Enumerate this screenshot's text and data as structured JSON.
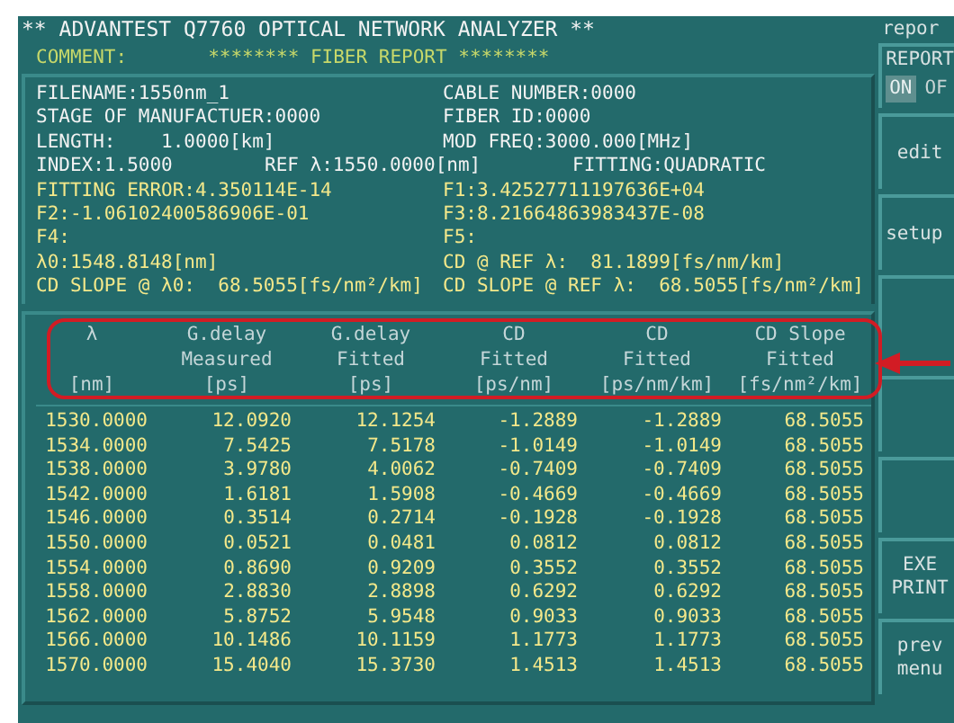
{
  "title": "** ADVANTEST Q7760 OPTICAL NETWORK ANALYZER **",
  "comment": {
    "label": "COMMENT:",
    "text": "******** FIBER REPORT ********"
  },
  "info_rows": [
    {
      "kind": "setting",
      "items": [
        "FILENAME:1550nm_1",
        "CABLE NUMBER:0000"
      ]
    },
    {
      "kind": "setting",
      "items": [
        "STAGE OF MANUFACTUER:0000",
        "FIBER ID:0000"
      ]
    },
    {
      "kind": "setting",
      "items": [
        "LENGTH:    1.0000[km]",
        "MOD FREQ:3000.000[MHz]"
      ]
    },
    {
      "kind": "setting",
      "items": [
        "INDEX:1.5000",
        "REF λ:1550.0000[nm]",
        "FITTING:QUADRATIC"
      ]
    },
    {
      "kind": "result",
      "items": [
        "FITTING ERROR:4.350114E-14",
        "F1:3.42527711197636E+04"
      ]
    },
    {
      "kind": "result",
      "items": [
        "F2:-1.06102400586906E-01",
        "F3:8.21664863983437E-08"
      ]
    },
    {
      "kind": "result",
      "items": [
        "F4:",
        "F5:"
      ]
    },
    {
      "kind": "result",
      "items": [
        "λ0:1548.8148[nm]",
        "CD @ REF λ:  81.1899[fs/nm/km]"
      ]
    },
    {
      "kind": "result",
      "items": [
        "CD SLOPE @ λ0:  68.5055[fs/nm²/km]",
        "CD SLOPE @ REF λ:  68.5055[fs/nm²/km]"
      ]
    }
  ],
  "table": {
    "header_highlighted": true,
    "columns": [
      {
        "lines": [
          "λ",
          "[nm]"
        ]
      },
      {
        "lines": [
          "G.delay",
          "Measured",
          "[ps]"
        ]
      },
      {
        "lines": [
          "G.delay",
          "Fitted",
          "[ps]"
        ]
      },
      {
        "lines": [
          "CD",
          "Fitted",
          "[ps/nm]"
        ]
      },
      {
        "lines": [
          "CD",
          "Fitted",
          "[ps/nm/km]"
        ]
      },
      {
        "lines": [
          "CD Slope",
          "Fitted",
          "[fs/nm²/km]"
        ]
      }
    ],
    "rows": [
      [
        "1530.0000",
        "12.0920",
        "12.1254",
        "-1.2889",
        "-1.2889",
        "68.5055"
      ],
      [
        "1534.0000",
        "7.5425",
        "7.5178",
        "-1.0149",
        "-1.0149",
        "68.5055"
      ],
      [
        "1538.0000",
        "3.9780",
        "4.0062",
        "-0.7409",
        "-0.7409",
        "68.5055"
      ],
      [
        "1542.0000",
        "1.6181",
        "1.5908",
        "-0.4669",
        "-0.4669",
        "68.5055"
      ],
      [
        "1546.0000",
        "0.3514",
        "0.2714",
        "-0.1928",
        "-0.1928",
        "68.5055"
      ],
      [
        "1550.0000",
        "0.0521",
        "0.0481",
        "0.0812",
        "0.0812",
        "68.5055"
      ],
      [
        "1554.0000",
        "0.8690",
        "0.9209",
        "0.3552",
        "0.3552",
        "68.5055"
      ],
      [
        "1558.0000",
        "2.8830",
        "2.8898",
        "0.6292",
        "0.6292",
        "68.5055"
      ],
      [
        "1562.0000",
        "5.8752",
        "5.9548",
        "0.9033",
        "0.9033",
        "68.5055"
      ],
      [
        "1566.0000",
        "10.1486",
        "10.1159",
        "1.1773",
        "1.1773",
        "68.5055"
      ],
      [
        "1570.0000",
        "15.4040",
        "15.3730",
        "1.4513",
        "1.4513",
        "68.5055"
      ]
    ]
  },
  "softkeys": [
    {
      "kind": "toggle",
      "heading": "repor",
      "label": "REPORT",
      "options": [
        {
          "label": "ON",
          "selected": true
        },
        {
          "label": "OF",
          "selected": false
        }
      ]
    },
    {
      "kind": "button",
      "lines": [
        "edit"
      ]
    },
    {
      "kind": "button",
      "lines": [
        "setup"
      ]
    },
    {
      "kind": "blank"
    },
    {
      "kind": "blank"
    },
    {
      "kind": "blank"
    },
    {
      "kind": "button",
      "lines": [
        "EXE",
        "PRINT"
      ]
    },
    {
      "kind": "button",
      "lines": [
        "prev",
        "menu"
      ]
    }
  ]
}
